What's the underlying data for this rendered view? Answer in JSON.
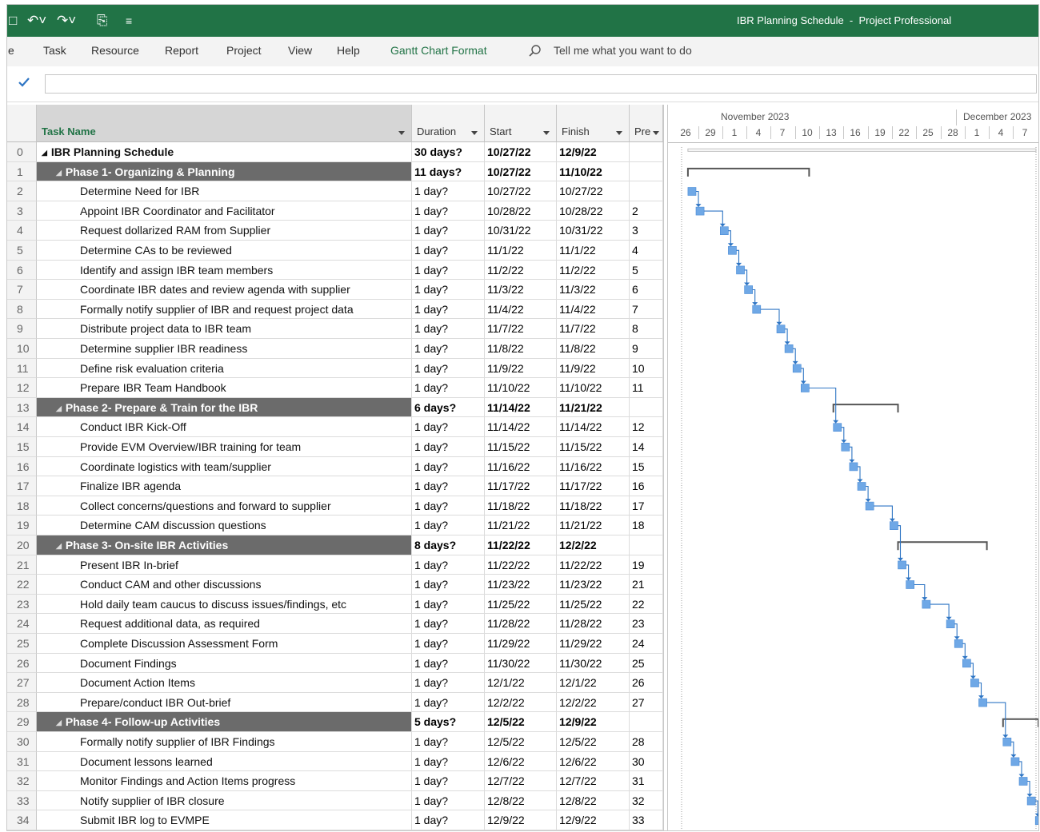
{
  "window": {
    "title": "IBR Planning Schedule  -  Project Professional"
  },
  "ribbon": {
    "tabs": [
      {
        "label": "e"
      },
      {
        "label": "Task"
      },
      {
        "label": "Resource"
      },
      {
        "label": "Report"
      },
      {
        "label": "Project"
      },
      {
        "label": "View"
      },
      {
        "label": "Help"
      },
      {
        "label": "Gantt Chart Format"
      }
    ],
    "tell_me": "Tell me what you want to do"
  },
  "columns": {
    "name": "Task Name",
    "duration": "Duration",
    "start": "Start",
    "finish": "Finish",
    "pred": "Pre"
  },
  "timescale": {
    "months": [
      "November 2023",
      "December 2023"
    ],
    "days": [
      "26",
      "29",
      "1",
      "4",
      "7",
      "10",
      "13",
      "16",
      "19",
      "22",
      "25",
      "28",
      "1",
      "4",
      "7"
    ]
  },
  "colors": {
    "titlebar": "#217346",
    "bar": "#6fa8e6",
    "link": "#2e75c4",
    "summary_row": "#6b6b6b"
  },
  "tasks": [
    {
      "id": "0",
      "name": "IBR Planning Schedule",
      "dur": "30 days?",
      "start": "10/27/22",
      "finish": "12/9/22",
      "pred": "",
      "level": 0,
      "type": "project"
    },
    {
      "id": "1",
      "name": "Phase 1- Organizing & Planning",
      "dur": "11 days?",
      "start": "10/27/22",
      "finish": "11/10/22",
      "pred": "",
      "level": 1,
      "type": "summary"
    },
    {
      "id": "2",
      "name": "Determine Need for IBR",
      "dur": "1 day?",
      "start": "10/27/22",
      "finish": "10/27/22",
      "pred": "",
      "level": 2,
      "type": "task"
    },
    {
      "id": "3",
      "name": "Appoint IBR Coordinator and Facilitator",
      "dur": "1 day?",
      "start": "10/28/22",
      "finish": "10/28/22",
      "pred": "2",
      "level": 2,
      "type": "task"
    },
    {
      "id": "4",
      "name": "Request dollarized RAM from Supplier",
      "dur": "1 day?",
      "start": "10/31/22",
      "finish": "10/31/22",
      "pred": "3",
      "level": 2,
      "type": "task"
    },
    {
      "id": "5",
      "name": "Determine CAs to be reviewed",
      "dur": "1 day?",
      "start": "11/1/22",
      "finish": "11/1/22",
      "pred": "4",
      "level": 2,
      "type": "task"
    },
    {
      "id": "6",
      "name": "Identify and assign IBR team members",
      "dur": "1 day?",
      "start": "11/2/22",
      "finish": "11/2/22",
      "pred": "5",
      "level": 2,
      "type": "task"
    },
    {
      "id": "7",
      "name": "Coordinate IBR dates and review agenda with supplier",
      "dur": "1 day?",
      "start": "11/3/22",
      "finish": "11/3/22",
      "pred": "6",
      "level": 2,
      "type": "task"
    },
    {
      "id": "8",
      "name": "Formally notify supplier of IBR and request project data",
      "dur": "1 day?",
      "start": "11/4/22",
      "finish": "11/4/22",
      "pred": "7",
      "level": 2,
      "type": "task"
    },
    {
      "id": "9",
      "name": "Distribute project data to IBR team",
      "dur": "1 day?",
      "start": "11/7/22",
      "finish": "11/7/22",
      "pred": "8",
      "level": 2,
      "type": "task"
    },
    {
      "id": "10",
      "name": "Determine supplier IBR readiness",
      "dur": "1 day?",
      "start": "11/8/22",
      "finish": "11/8/22",
      "pred": "9",
      "level": 2,
      "type": "task"
    },
    {
      "id": "11",
      "name": "Define risk evaluation criteria",
      "dur": "1 day?",
      "start": "11/9/22",
      "finish": "11/9/22",
      "pred": "10",
      "level": 2,
      "type": "task"
    },
    {
      "id": "12",
      "name": "Prepare IBR Team Handbook",
      "dur": "1 day?",
      "start": "11/10/22",
      "finish": "11/10/22",
      "pred": "11",
      "level": 2,
      "type": "task"
    },
    {
      "id": "13",
      "name": "Phase 2- Prepare & Train for the IBR",
      "dur": "6 days?",
      "start": "11/14/22",
      "finish": "11/21/22",
      "pred": "",
      "level": 1,
      "type": "summary"
    },
    {
      "id": "14",
      "name": "Conduct IBR Kick-Off",
      "dur": "1 day?",
      "start": "11/14/22",
      "finish": "11/14/22",
      "pred": "12",
      "level": 2,
      "type": "task"
    },
    {
      "id": "15",
      "name": "Provide EVM Overview/IBR training for team",
      "dur": "1 day?",
      "start": "11/15/22",
      "finish": "11/15/22",
      "pred": "14",
      "level": 2,
      "type": "task"
    },
    {
      "id": "16",
      "name": "Coordinate logistics with team/supplier",
      "dur": "1 day?",
      "start": "11/16/22",
      "finish": "11/16/22",
      "pred": "15",
      "level": 2,
      "type": "task"
    },
    {
      "id": "17",
      "name": "Finalize IBR agenda",
      "dur": "1 day?",
      "start": "11/17/22",
      "finish": "11/17/22",
      "pred": "16",
      "level": 2,
      "type": "task"
    },
    {
      "id": "18",
      "name": "Collect concerns/questions and forward to supplier",
      "dur": "1 day?",
      "start": "11/18/22",
      "finish": "11/18/22",
      "pred": "17",
      "level": 2,
      "type": "task"
    },
    {
      "id": "19",
      "name": "Determine CAM discussion questions",
      "dur": "1 day?",
      "start": "11/21/22",
      "finish": "11/21/22",
      "pred": "18",
      "level": 2,
      "type": "task"
    },
    {
      "id": "20",
      "name": "Phase 3- On-site IBR Activities",
      "dur": "8 days?",
      "start": "11/22/22",
      "finish": "12/2/22",
      "pred": "",
      "level": 1,
      "type": "summary"
    },
    {
      "id": "21",
      "name": "Present IBR In-brief",
      "dur": "1 day?",
      "start": "11/22/22",
      "finish": "11/22/22",
      "pred": "19",
      "level": 2,
      "type": "task"
    },
    {
      "id": "22",
      "name": "Conduct CAM and other discussions",
      "dur": "1 day?",
      "start": "11/23/22",
      "finish": "11/23/22",
      "pred": "21",
      "level": 2,
      "type": "task"
    },
    {
      "id": "23",
      "name": "Hold daily team caucus to discuss issues/findings, etc",
      "dur": "1 day?",
      "start": "11/25/22",
      "finish": "11/25/22",
      "pred": "22",
      "level": 2,
      "type": "task"
    },
    {
      "id": "24",
      "name": "Request additional data, as required",
      "dur": "1 day?",
      "start": "11/28/22",
      "finish": "11/28/22",
      "pred": "23",
      "level": 2,
      "type": "task"
    },
    {
      "id": "25",
      "name": "Complete Discussion Assessment Form",
      "dur": "1 day?",
      "start": "11/29/22",
      "finish": "11/29/22",
      "pred": "24",
      "level": 2,
      "type": "task"
    },
    {
      "id": "26",
      "name": "Document Findings",
      "dur": "1 day?",
      "start": "11/30/22",
      "finish": "11/30/22",
      "pred": "25",
      "level": 2,
      "type": "task"
    },
    {
      "id": "27",
      "name": "Document Action Items",
      "dur": "1 day?",
      "start": "12/1/22",
      "finish": "12/1/22",
      "pred": "26",
      "level": 2,
      "type": "task"
    },
    {
      "id": "28",
      "name": "Prepare/conduct IBR Out-brief",
      "dur": "1 day?",
      "start": "12/2/22",
      "finish": "12/2/22",
      "pred": "27",
      "level": 2,
      "type": "task"
    },
    {
      "id": "29",
      "name": "Phase 4- Follow-up Activities",
      "dur": "5 days?",
      "start": "12/5/22",
      "finish": "12/9/22",
      "pred": "",
      "level": 1,
      "type": "summary"
    },
    {
      "id": "30",
      "name": "Formally notify supplier of IBR Findings",
      "dur": "1 day?",
      "start": "12/5/22",
      "finish": "12/5/22",
      "pred": "28",
      "level": 2,
      "type": "task"
    },
    {
      "id": "31",
      "name": "Document lessons learned",
      "dur": "1 day?",
      "start": "12/6/22",
      "finish": "12/6/22",
      "pred": "30",
      "level": 2,
      "type": "task"
    },
    {
      "id": "32",
      "name": "Monitor Findings and Action Items progress",
      "dur": "1 day?",
      "start": "12/7/22",
      "finish": "12/7/22",
      "pred": "31",
      "level": 2,
      "type": "task"
    },
    {
      "id": "33",
      "name": "Notify supplier of IBR closure",
      "dur": "1 day?",
      "start": "12/8/22",
      "finish": "12/8/22",
      "pred": "32",
      "level": 2,
      "type": "task"
    },
    {
      "id": "34",
      "name": "Submit IBR log to EVMPE",
      "dur": "1 day?",
      "start": "12/9/22",
      "finish": "12/9/22",
      "pred": "33",
      "level": 2,
      "type": "task"
    }
  ]
}
